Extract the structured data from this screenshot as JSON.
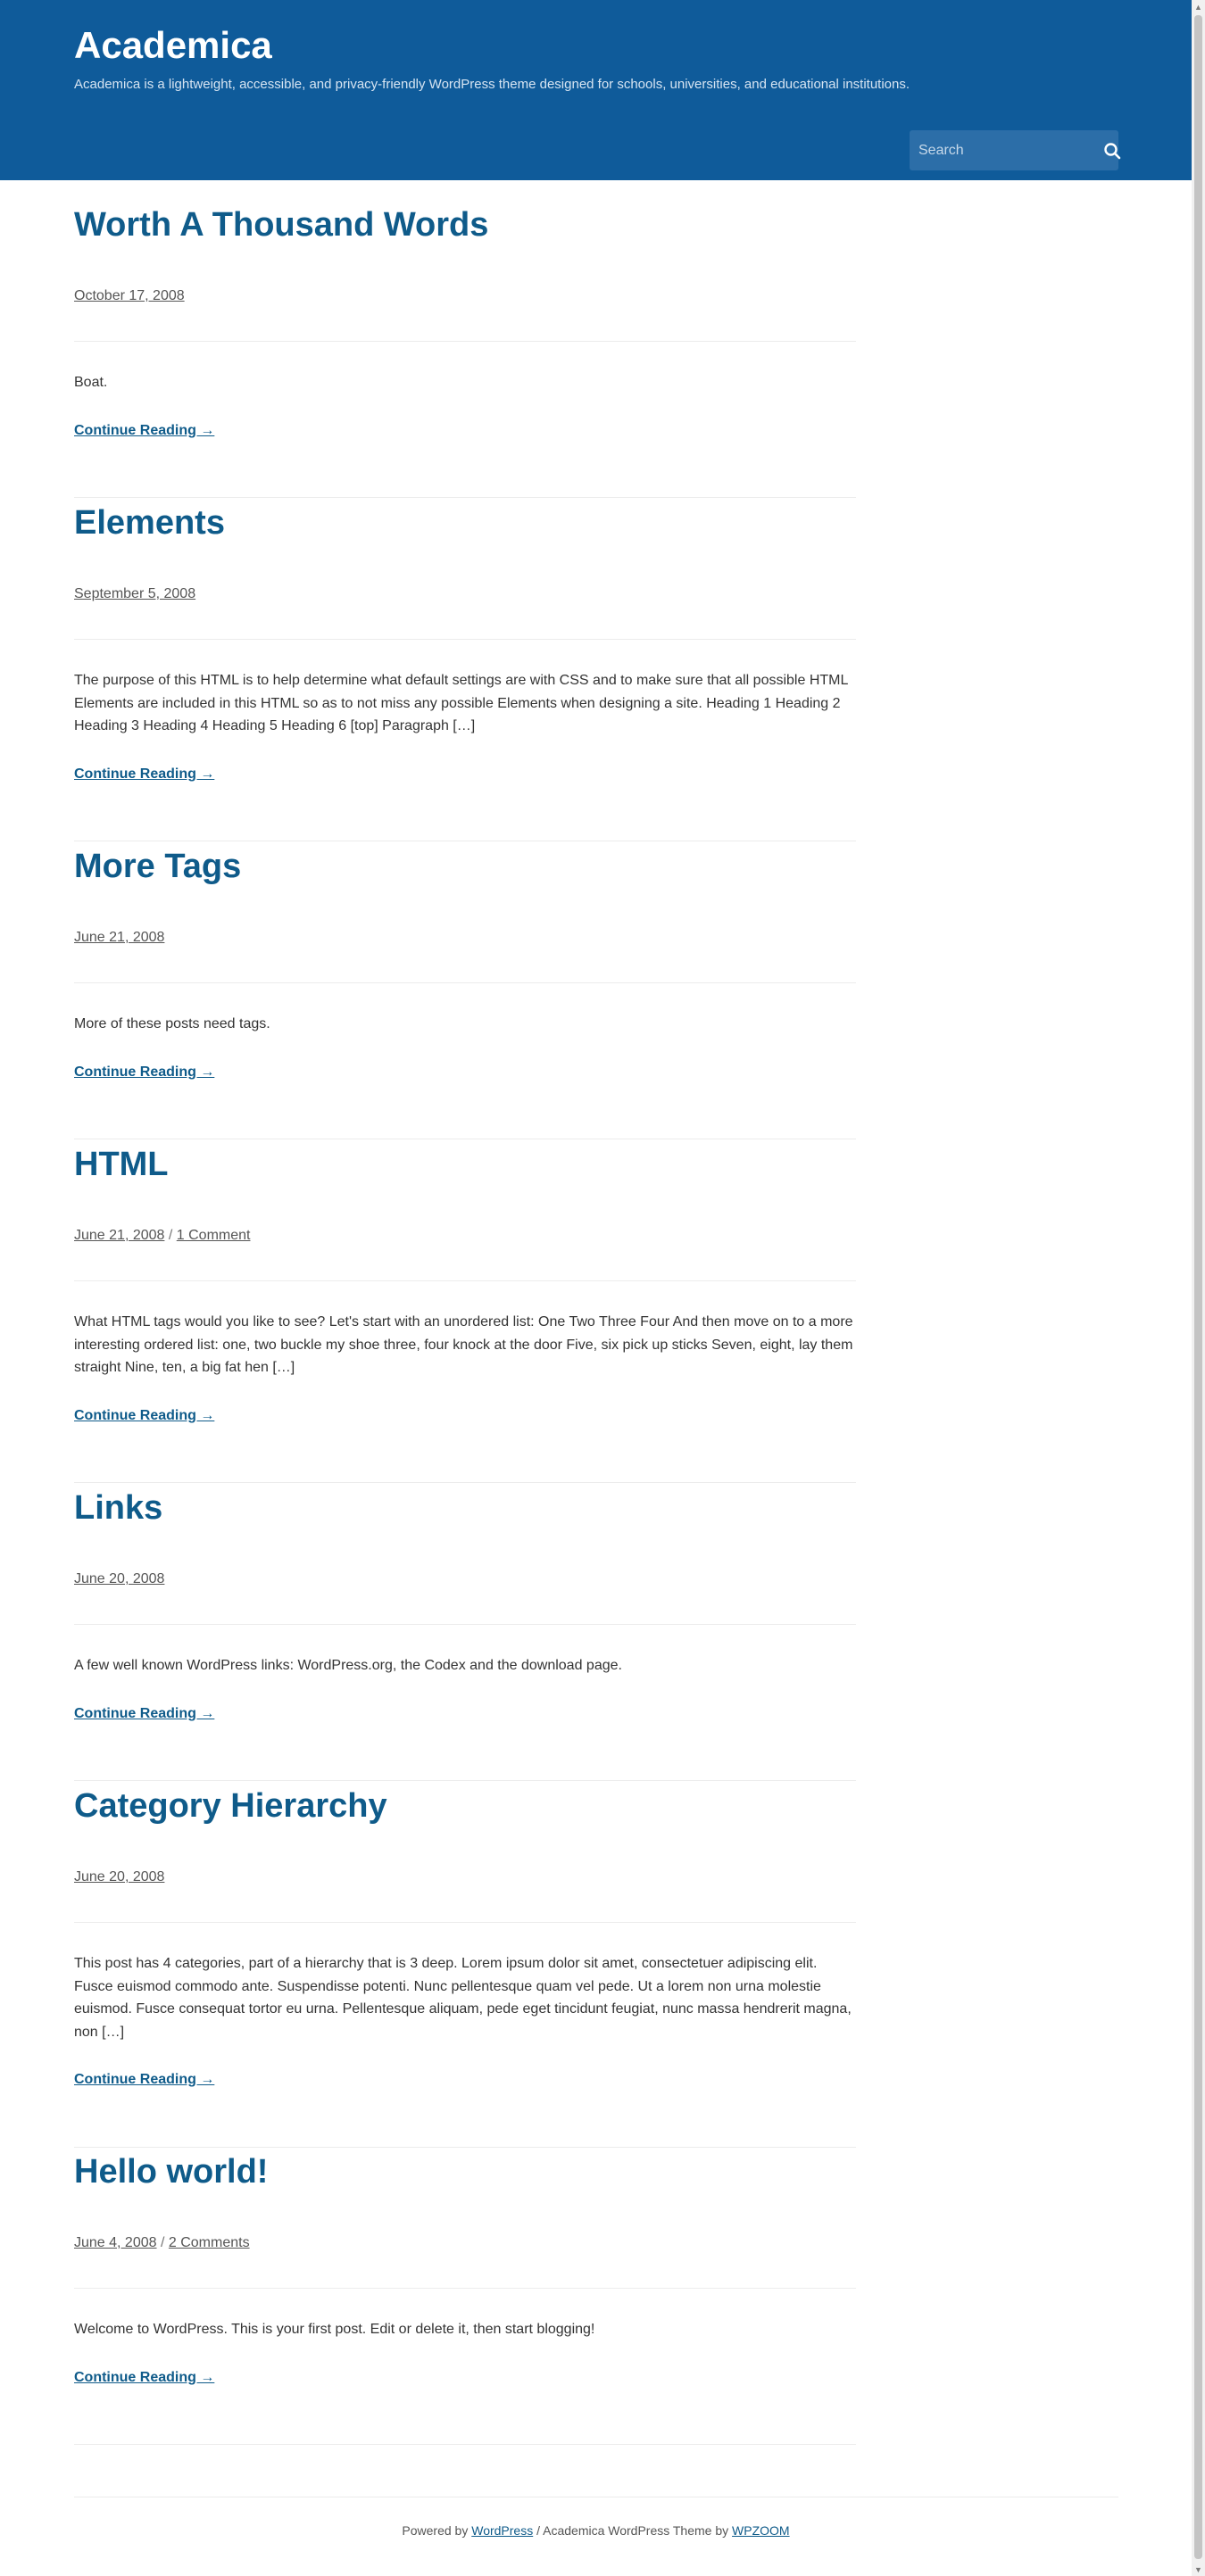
{
  "site": {
    "title": "Academica",
    "description": "Academica is a lightweight, accessible, and privacy-friendly WordPress theme designed for schools, universities, and educational institutions."
  },
  "search": {
    "placeholder": "Search"
  },
  "colors": {
    "header_bg": "#0f5b9a",
    "link": "#0f5b8a"
  },
  "posts": [
    {
      "title": "Worth A Thousand Words",
      "date": "October 17, 2008",
      "comments": "",
      "excerpt": "Boat.",
      "read_more": "Continue Reading →"
    },
    {
      "title": "Elements",
      "date": "September 5, 2008",
      "comments": "",
      "excerpt": "The purpose of this HTML is to help determine what default settings are with CSS and to make sure that all possible HTML Elements are included in this HTML so as to not miss any possible Elements when designing a site. Heading 1 Heading 2 Heading 3 Heading 4 Heading 5 Heading 6 [top] Paragraph […]",
      "read_more": "Continue Reading →"
    },
    {
      "title": "More Tags",
      "date": "June 21, 2008",
      "comments": "",
      "excerpt": "More of these posts need tags.",
      "read_more": "Continue Reading →"
    },
    {
      "title": "HTML",
      "date": "June 21, 2008",
      "comments": "1 Comment",
      "excerpt": "What HTML tags would you like to see? Let's start with an unordered list: One Two Three Four And then move on to a more interesting ordered list: one, two buckle my shoe three, four knock at the door Five, six pick up sticks Seven, eight, lay them straight Nine, ten, a big fat hen […]",
      "read_more": "Continue Reading →"
    },
    {
      "title": "Links",
      "date": "June 20, 2008",
      "comments": "",
      "excerpt": "A few well known WordPress links: WordPress.org, the Codex and the download page.",
      "read_more": "Continue Reading →"
    },
    {
      "title": "Category Hierarchy",
      "date": "June 20, 2008",
      "comments": "",
      "excerpt": "This post has 4 categories, part of a hierarchy that is 3 deep. Lorem ipsum dolor sit amet, consectetuer adipiscing elit. Fusce euismod commodo ante. Suspendisse potenti. Nunc pellentesque quam vel pede. Ut a lorem non urna molestie euismod. Fusce consequat tortor eu urna. Pellentesque aliquam, pede eget tincidunt feugiat, nunc massa hendrerit magna, non […]",
      "read_more": "Continue Reading →"
    },
    {
      "title": "Hello world!",
      "date": "June 4, 2008",
      "comments": "2 Comments",
      "excerpt": "Welcome to WordPress. This is your first post. Edit or delete it, then start blogging!",
      "read_more": "Continue Reading →"
    }
  ],
  "meta_separator": "/",
  "footer": {
    "powered_by": "Powered by",
    "wordpress_link": "WordPress",
    "theme_text": "/ Academica WordPress Theme by",
    "wpzoom_link": "WPZOOM"
  }
}
